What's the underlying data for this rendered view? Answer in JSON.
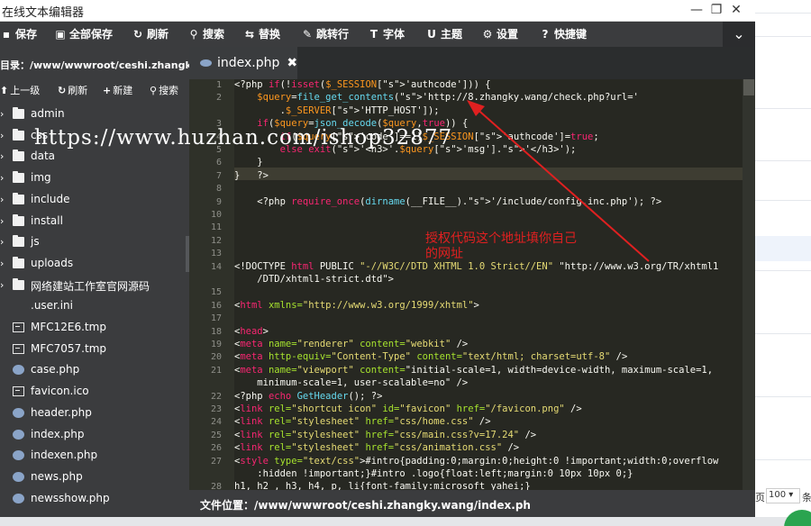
{
  "window": {
    "title": "在线文本编辑器"
  },
  "toolbar": {
    "save": "保存",
    "save_all": "全部保存",
    "refresh": "刷新",
    "search": "搜索",
    "replace": "替换",
    "goto_line": "跳转行",
    "font": "字体",
    "theme": "主题",
    "settings": "设置",
    "shortcuts": "快捷键"
  },
  "sidebar": {
    "path": "目录：/www/wwwroot/ceshi.zhangky.w...",
    "actions": {
      "up": "上一级",
      "refresh": "刷新",
      "new": "新建",
      "search": "搜索"
    },
    "items": [
      {
        "name": "admin",
        "type": "folder"
      },
      {
        "name": "css",
        "type": "folder"
      },
      {
        "name": "data",
        "type": "folder"
      },
      {
        "name": "img",
        "type": "folder"
      },
      {
        "name": "include",
        "type": "folder"
      },
      {
        "name": "install",
        "type": "folder"
      },
      {
        "name": "js",
        "type": "folder"
      },
      {
        "name": "uploads",
        "type": "folder"
      },
      {
        "name": "网络建站工作室官网源码",
        "type": "folder"
      },
      {
        "name": ".user.ini",
        "type": "plain"
      },
      {
        "name": "MFC12E6.tmp",
        "type": "file"
      },
      {
        "name": "MFC7057.tmp",
        "type": "file"
      },
      {
        "name": "case.php",
        "type": "php"
      },
      {
        "name": "favicon.ico",
        "type": "file"
      },
      {
        "name": "header.php",
        "type": "php"
      },
      {
        "name": "index.php",
        "type": "php"
      },
      {
        "name": "indexen.php",
        "type": "php"
      },
      {
        "name": "news.php",
        "type": "php"
      },
      {
        "name": "newsshow.php",
        "type": "php"
      }
    ]
  },
  "editor": {
    "tab_label": "index.php",
    "line_numbers": [
      "1",
      "2",
      "",
      "3",
      "4",
      "5",
      "6",
      "7",
      "8",
      "9",
      "10",
      "11",
      "12",
      "13",
      "14",
      "",
      "15",
      "16",
      "17",
      "18",
      "19",
      "20",
      "21",
      "",
      "22",
      "23",
      "24",
      "25",
      "26",
      "27",
      "",
      "28"
    ],
    "code_lines": [
      "<?php if(!isset($_SESSION['authcode'])) {",
      "    $query=file_get_contents('http://8.zhangky.wang/check.php?url='",
      "        .$_SERVER['HTTP_HOST']);",
      "    if($query=json_decode($query,true)) {",
      "        if($query['code']==1)$_SESSION['authcode']=true;",
      "        else exit('<h3>'.$query['msg'].'</h3>');",
      "    }",
      "}   ?>",
      "",
      "    <?php require_once(dirname(__FILE__).'/include/config.inc.php'); ?>",
      "",
      "",
      "",
      "",
      "<!DOCTYPE html PUBLIC \"-//W3C//DTD XHTML 1.0 Strict//EN\" \"http://www.w3.org/TR/xhtml1",
      "    /DTD/xhtml1-strict.dtd\">",
      "",
      "<html xmlns=\"http://www.w3.org/1999/xhtml\">",
      "",
      "<head>",
      "<meta name=\"renderer\" content=\"webkit\" />",
      "<meta http-equiv=\"Content-Type\" content=\"text/html; charset=utf-8\" />",
      "<meta name=\"viewport\" content=\"initial-scale=1, width=device-width, maximum-scale=1,",
      "    minimum-scale=1, user-scalable=no\" />",
      "<?php echo GetHeader(); ?>",
      "<link rel=\"shortcut icon\" id=\"favicon\" href=\"/favicon.png\" />",
      "<link rel=\"stylesheet\" href=\"css/home.css\" />",
      "<link rel=\"stylesheet\" href=\"css/main.css?v=17.24\" />",
      "<link rel=\"stylesheet\" href=\"css/animation.css\" />",
      "<style type=\"text/css\">#intro{padding:0;margin:0;height:0 !important;width:0;overflow",
      "    :hidden !important;}#intro .logo{float:left;margin:0 10px 10px 0;}",
      "h1, h2 , h3, h4, p, li{font-family:microsoft yahei;}"
    ]
  },
  "status": {
    "file_location": "文件位置：/www/wwwroot/ceshi.zhangky.wang/index.ph"
  },
  "watermark": {
    "text": "https://www.huzhan.com/ishop32877"
  },
  "annotation": {
    "text": "授权代码这个地址填你自己的网址"
  },
  "background_page": {
    "pager_left": "页",
    "page_size": "100",
    "pager_right": "条"
  },
  "colors": {
    "annotation": "#e02020",
    "editor_bg": "#272822",
    "panel_bg": "#3b3c3e"
  }
}
